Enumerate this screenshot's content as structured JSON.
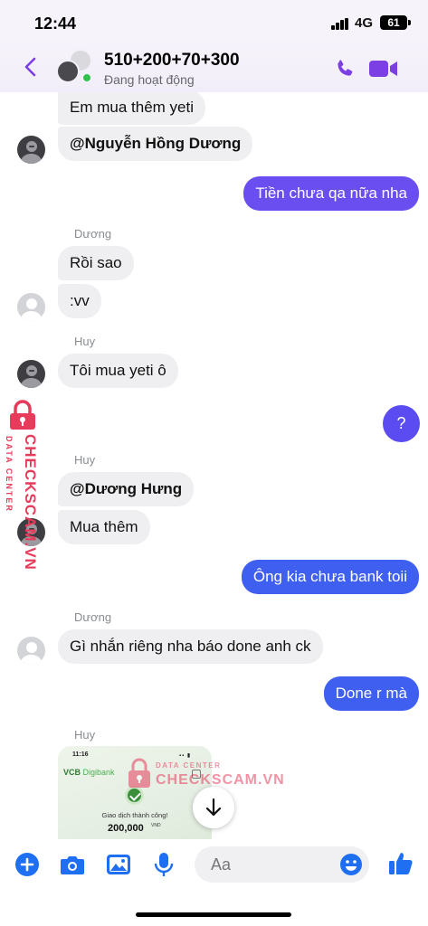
{
  "status_bar": {
    "time": "12:44",
    "network": "4G",
    "battery": "61"
  },
  "header": {
    "title": "510+200+70+300",
    "subtitle": "Đang hoạt động",
    "accent": "#7b3fe4"
  },
  "messages": [
    {
      "side": "in",
      "text": "Em mua thêm yeti"
    },
    {
      "side": "in",
      "text": "@Nguyễn Hồng Dương",
      "bold": true
    },
    {
      "side": "out",
      "text": "Tiền chưa qa nữa nha"
    },
    {
      "sender": "Dương"
    },
    {
      "side": "in",
      "text": "Rồi sao"
    },
    {
      "side": "in",
      "text": ":vv"
    },
    {
      "sender": "Huy"
    },
    {
      "side": "in",
      "text": "Tôi mua yeti ô"
    },
    {
      "side": "out",
      "text": "?"
    },
    {
      "sender": "Huy"
    },
    {
      "side": "in",
      "text": "@Dương Hưng",
      "bold": true
    },
    {
      "side": "in",
      "text": "Mua thêm"
    },
    {
      "side": "out",
      "text": "Ông kia chưa bank toii"
    },
    {
      "sender": "Dương"
    },
    {
      "side": "in",
      "text": "Gì nhắn riêng nha báo done anh ck"
    },
    {
      "side": "out",
      "text": "Done r mà"
    },
    {
      "sender": "Huy"
    }
  ],
  "image_preview": {
    "time": "11:16",
    "bank_logo_main": "VCB",
    "bank_logo_sub": "Digibank",
    "status": "Giao dịch thành công!",
    "amount": "200,000",
    "currency": "VND"
  },
  "watermark": {
    "brand": "CHECKSCAM.VN",
    "tagline": "DATA CENTER",
    "color": "#e63b5b"
  },
  "composer": {
    "placeholder": "Aa"
  },
  "colors": {
    "outgoing_purple": "#6b4ef0",
    "outgoing_blue": "#3f5ff0",
    "incoming": "#efeff1",
    "icon_blue": "#1f6ff2"
  }
}
